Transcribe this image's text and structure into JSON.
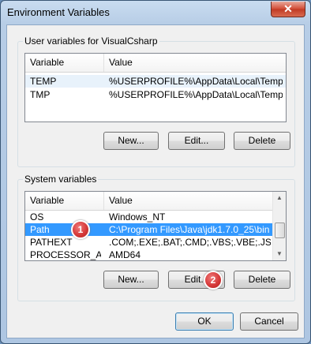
{
  "window": {
    "title": "Environment Variables",
    "close_symbol": "✕"
  },
  "user_group": {
    "label": "User variables for VisualCsharp",
    "columns": [
      "Variable",
      "Value"
    ],
    "rows": [
      {
        "variable": "TEMP",
        "value": "%USERPROFILE%\\AppData\\Local\\Temp"
      },
      {
        "variable": "TMP",
        "value": "%USERPROFILE%\\AppData\\Local\\Temp"
      }
    ],
    "buttons": {
      "new": "New...",
      "edit": "Edit...",
      "delete": "Delete"
    }
  },
  "system_group": {
    "label": "System variables",
    "columns": [
      "Variable",
      "Value"
    ],
    "rows": [
      {
        "variable": "OS",
        "value": "Windows_NT"
      },
      {
        "variable": "Path",
        "value": "C:\\Program Files\\Java\\jdk1.7.0_25\\bin"
      },
      {
        "variable": "PATHEXT",
        "value": ".COM;.EXE;.BAT;.CMD;.VBS;.VBE;.JS;...."
      },
      {
        "variable": "PROCESSOR_A...",
        "value": "AMD64"
      }
    ],
    "selected_row": "Path",
    "buttons": {
      "new": "New...",
      "edit": "Edit...",
      "delete": "Delete"
    }
  },
  "footer": {
    "ok": "OK",
    "cancel": "Cancel"
  },
  "annotations": {
    "badge_1": "1",
    "badge_2": "2"
  },
  "colors": {
    "selection": "#3399ff",
    "badge": "#d63a3a",
    "title_bar": "#b7cde6"
  }
}
